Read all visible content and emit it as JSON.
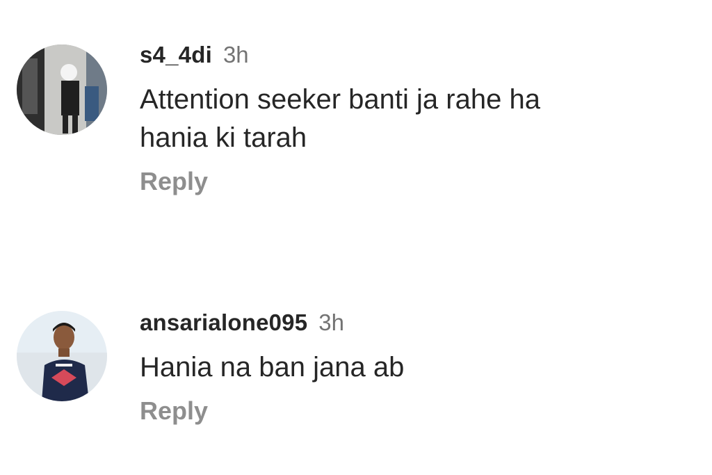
{
  "comments": [
    {
      "username": "s4_4di",
      "time": "3h",
      "text_line1": "Attention seeker banti ja rahe ha",
      "text_line2": "hania ki tarah",
      "reply_label": "Reply"
    },
    {
      "username": "ansarialone095",
      "time": "3h",
      "text_line1": "Hania na ban jana ab",
      "reply_label": "Reply"
    }
  ],
  "colors": {
    "username": "#262626",
    "timestamp": "#737373",
    "reply": "#8e8e8e",
    "background": "#ffffff"
  }
}
